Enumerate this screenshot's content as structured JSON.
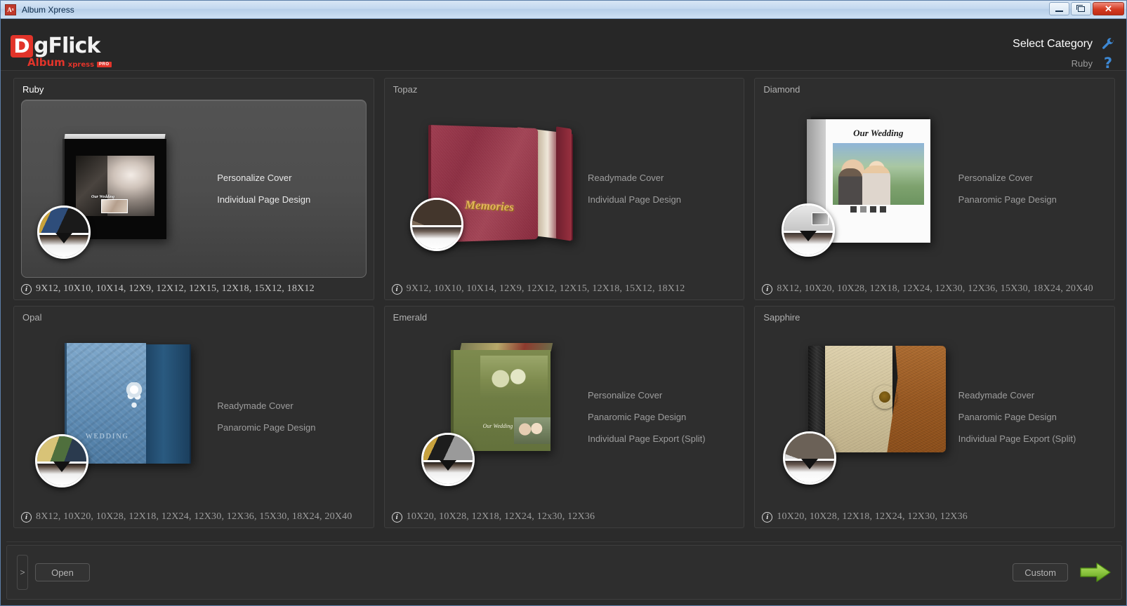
{
  "window": {
    "title": "Album Xpress",
    "app_icon": "album-xpress-icon",
    "minimize_label": "Minimize",
    "restore_label": "Restore",
    "close_label": "✕"
  },
  "header": {
    "logo": {
      "mark": "D",
      "word": "gFlick",
      "sub_album": "Album",
      "sub_xpress": "xpress",
      "badge": "PRO"
    },
    "select_category_label": "Select Category",
    "selected_category": "Ruby",
    "settings_icon": "wrench-icon",
    "help_icon": "question-mark-icon",
    "help_glyph": "?"
  },
  "cards": [
    {
      "name": "Ruby",
      "selected": true,
      "features": [
        "Personalize Cover",
        "Individual Page Design"
      ],
      "sizes": "9X12, 10X10, 10X14, 12X9, 12X12, 12X15, 12X18, 15X12, 18X12",
      "cover_text": "Our Wedding"
    },
    {
      "name": "Topaz",
      "selected": false,
      "features": [
        "Readymade Cover",
        "Individual Page Design"
      ],
      "sizes": "9X12, 10X10, 10X14, 12X9, 12X12, 12X15, 12X18, 15X12, 18X12",
      "cover_text": "Memories"
    },
    {
      "name": "Diamond",
      "selected": false,
      "features": [
        "Personalize Cover",
        "Panaromic Page Design"
      ],
      "sizes": "8X12, 10X20, 10X28, 12X18, 12X24, 12X30, 12X36, 15X30, 18X24, 20X40",
      "cover_text": "Our Wedding"
    },
    {
      "name": "Opal",
      "selected": false,
      "features": [
        "Readymade Cover",
        "Panaromic Page Design"
      ],
      "sizes": "8X12, 10X20, 10X28, 12X18, 12X24, 12X30, 12X36, 15X30, 18X24, 20X40",
      "cover_text": "WEDDING"
    },
    {
      "name": "Emerald",
      "selected": false,
      "features": [
        "Personalize Cover",
        "Panaromic Page Design",
        "Individual Page Export (Split)"
      ],
      "sizes": "10X20, 10X28, 12X18, 12X24, 12x30, 12X36",
      "cover_text": "Our Wedding"
    },
    {
      "name": "Sapphire",
      "selected": false,
      "features": [
        "Readymade Cover",
        "Panaromic Page Design",
        "Individual Page Export (Split)"
      ],
      "sizes": "10X20, 10X28, 12X18, 12X24, 12X30, 12X36",
      "cover_text": ""
    }
  ],
  "info_glyph": "i",
  "footer": {
    "collapse_label": ">",
    "open_label": "Open",
    "custom_label": "Custom",
    "next_icon": "green-arrow-right-icon"
  },
  "colors": {
    "accent_red": "#e2342a",
    "accent_blue": "#3d88d4",
    "next_green": "#8cc63f",
    "panel_bg": "#2e2e2e",
    "app_bg": "#272727",
    "titlebar": "#c3d8ef"
  },
  "diamond_dots": [
    "#3b3b3b",
    "#8d8d8d",
    "#3b3b3b",
    "#3b3b3b"
  ]
}
